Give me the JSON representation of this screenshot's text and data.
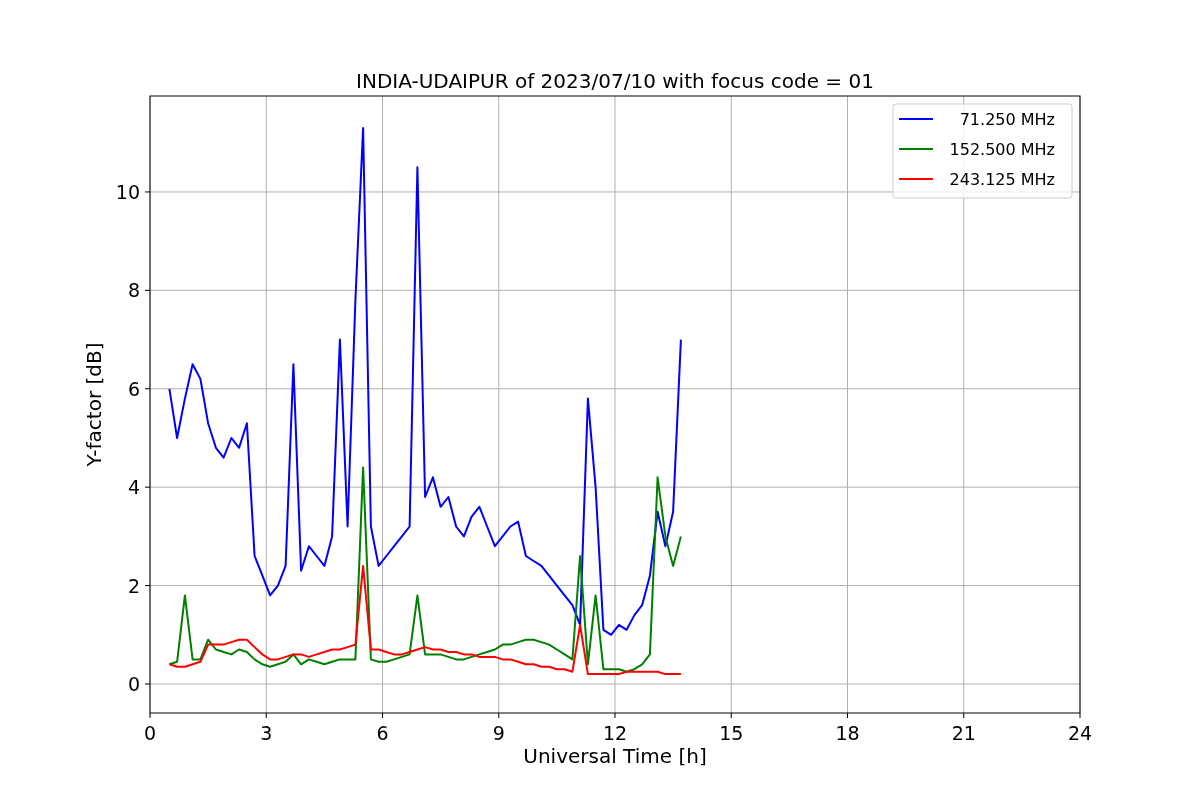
{
  "figure": {
    "chart_data": {
      "type": "line",
      "title": "INDIA-UDAIPUR of 2023/07/10 with focus code = 01",
      "xlabel": "Universal Time [h]",
      "ylabel": "Y-factor [dB]",
      "x": [
        0.5,
        0.7,
        0.9,
        1.1,
        1.3,
        1.5,
        1.7,
        1.9,
        2.1,
        2.3,
        2.5,
        2.7,
        2.9,
        3.1,
        3.3,
        3.5,
        3.7,
        3.9,
        4.1,
        4.3,
        4.5,
        4.7,
        4.9,
        5.1,
        5.3,
        5.5,
        5.7,
        5.9,
        6.1,
        6.3,
        6.5,
        6.7,
        6.9,
        7.1,
        7.3,
        7.5,
        7.7,
        7.9,
        8.1,
        8.3,
        8.5,
        8.7,
        8.9,
        9.1,
        9.3,
        9.5,
        9.7,
        9.9,
        10.1,
        10.3,
        10.5,
        10.7,
        10.9,
        11.1,
        11.3,
        11.5,
        11.7,
        11.9,
        12.1,
        12.3,
        12.5,
        12.7,
        12.9,
        13.1,
        13.3,
        13.5,
        13.7
      ],
      "series": [
        {
          "name": "71.250 MHz",
          "color": "#0000ff",
          "values": [
            6.0,
            5.0,
            5.8,
            6.5,
            6.2,
            5.3,
            4.8,
            4.6,
            5.0,
            4.8,
            5.3,
            2.6,
            2.2,
            1.8,
            2.0,
            2.4,
            6.5,
            2.3,
            2.8,
            2.6,
            2.4,
            3.0,
            7.0,
            3.2,
            7.8,
            11.3,
            3.2,
            2.4,
            2.6,
            2.8,
            3.0,
            3.2,
            10.5,
            3.8,
            4.2,
            3.6,
            3.8,
            3.2,
            3.0,
            3.4,
            3.6,
            3.2,
            2.8,
            3.0,
            3.2,
            3.3,
            2.6,
            2.5,
            2.4,
            2.2,
            2.0,
            1.8,
            1.6,
            1.2,
            5.8,
            4.0,
            1.1,
            1.0,
            1.2,
            1.1,
            1.4,
            1.6,
            2.2,
            3.5,
            2.8,
            3.5,
            7.0
          ]
        },
        {
          "name": "152.500 MHz",
          "color": "#008000",
          "values": [
            0.4,
            0.45,
            1.8,
            0.5,
            0.5,
            0.9,
            0.7,
            0.65,
            0.6,
            0.7,
            0.65,
            0.5,
            0.4,
            0.35,
            0.4,
            0.45,
            0.6,
            0.4,
            0.5,
            0.45,
            0.4,
            0.45,
            0.5,
            0.5,
            0.5,
            4.4,
            0.5,
            0.45,
            0.45,
            0.5,
            0.55,
            0.6,
            1.8,
            0.6,
            0.6,
            0.6,
            0.55,
            0.5,
            0.5,
            0.55,
            0.6,
            0.65,
            0.7,
            0.8,
            0.8,
            0.85,
            0.9,
            0.9,
            0.85,
            0.8,
            0.7,
            0.6,
            0.5,
            2.6,
            0.4,
            1.8,
            0.3,
            0.3,
            0.3,
            0.25,
            0.3,
            0.4,
            0.6,
            4.2,
            3.0,
            2.4,
            3.0
          ]
        },
        {
          "name": "243.125 MHz",
          "color": "#ff0000",
          "values": [
            0.4,
            0.35,
            0.35,
            0.4,
            0.45,
            0.8,
            0.8,
            0.8,
            0.85,
            0.9,
            0.9,
            0.75,
            0.6,
            0.5,
            0.5,
            0.55,
            0.6,
            0.6,
            0.55,
            0.6,
            0.65,
            0.7,
            0.7,
            0.75,
            0.8,
            2.4,
            0.7,
            0.7,
            0.65,
            0.6,
            0.6,
            0.65,
            0.7,
            0.75,
            0.7,
            0.7,
            0.65,
            0.65,
            0.6,
            0.6,
            0.55,
            0.55,
            0.55,
            0.5,
            0.5,
            0.45,
            0.4,
            0.4,
            0.35,
            0.35,
            0.3,
            0.3,
            0.25,
            1.2,
            0.2,
            0.2,
            0.2,
            0.2,
            0.2,
            0.25,
            0.25,
            0.25,
            0.25,
            0.25,
            0.2,
            0.2,
            0.2
          ]
        }
      ],
      "xlim": [
        0,
        24
      ],
      "ylim": [
        -0.59,
        11.95
      ],
      "xticks": [
        0,
        3,
        6,
        9,
        12,
        15,
        18,
        21,
        24
      ],
      "yticks": [
        0,
        2,
        4,
        6,
        8,
        10
      ],
      "grid": true,
      "legend": true
    }
  }
}
